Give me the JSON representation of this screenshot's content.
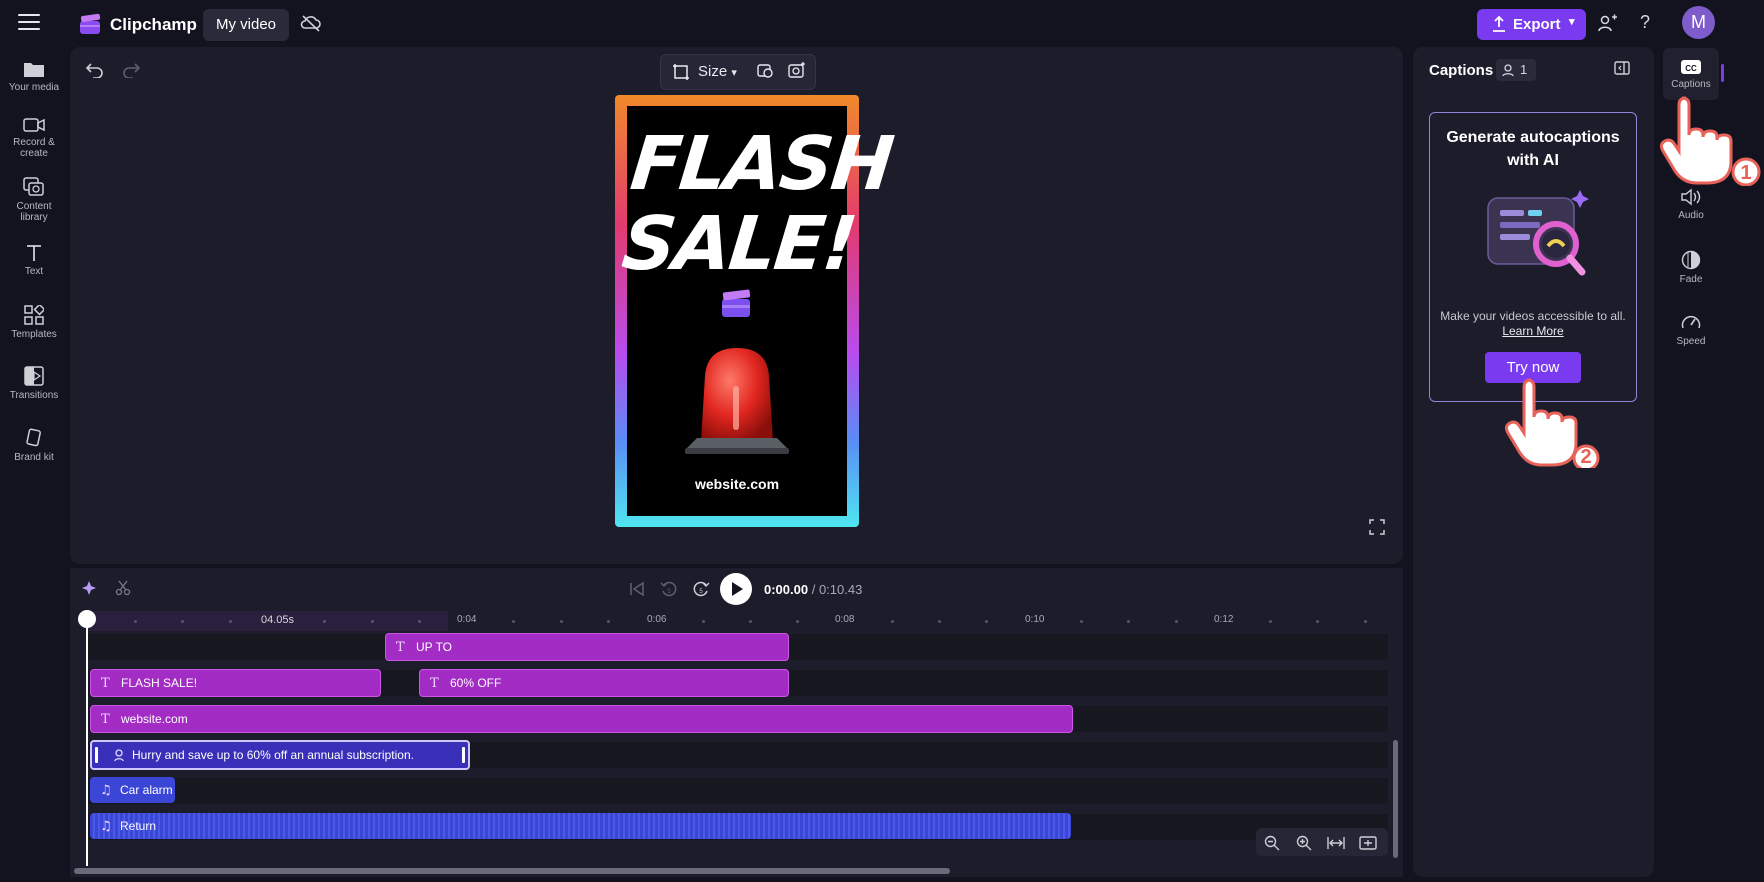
{
  "app": {
    "name": "Clipchamp",
    "project_name": "My video",
    "export_label": "Export",
    "avatar_initial": "M"
  },
  "sidebar": {
    "items": [
      {
        "label": "Your media",
        "icon": "folder-icon"
      },
      {
        "label": "Record & create",
        "icon": "camera-icon"
      },
      {
        "label": "Content library",
        "icon": "library-icon"
      },
      {
        "label": "Text",
        "icon": "text-icon"
      },
      {
        "label": "Templates",
        "icon": "templates-icon"
      },
      {
        "label": "Transitions",
        "icon": "transitions-icon"
      },
      {
        "label": "Brand kit",
        "icon": "brand-kit-icon"
      }
    ]
  },
  "preview": {
    "size_label": "Size",
    "video_title": "FLASH SALE!",
    "video_website": "website.com"
  },
  "captions_panel": {
    "title": "Captions",
    "badge_count": "1",
    "card_title": "Generate autocaptions with AI",
    "card_text": "Make your videos accessible to all.",
    "learn_more": "Learn More",
    "try_now": "Try now"
  },
  "right_rail": {
    "items": [
      {
        "label": "Captions",
        "icon": "cc-icon",
        "active": true
      },
      {
        "label": "Audio",
        "icon": "speaker-icon"
      },
      {
        "label": "Fade",
        "icon": "fade-icon"
      },
      {
        "label": "Speed",
        "icon": "speed-icon"
      }
    ]
  },
  "timeline": {
    "current_time": "0:00.00",
    "total_time": "/ 0:10.43",
    "playhead_label": "04.05s",
    "ruler_labels": [
      "0:04",
      "0:06",
      "0:08",
      "0:10",
      "0:12"
    ],
    "clips": {
      "up_to": "UP TO",
      "flash_sale": "FLASH SALE!",
      "sixty_off": "60% OFF",
      "website": "website.com",
      "caption": "Hurry and save up to 60% off an annual subscription.",
      "car_alarm": "Car alarm",
      "return": "Return"
    }
  },
  "annotations": {
    "step1": "1",
    "step2": "2"
  },
  "colors": {
    "accent": "#7a3af0",
    "text_clip": "#a32cc4",
    "audio_clip": "#3b46d6",
    "caption_clip": "#3a2fb8",
    "background": "#131320",
    "panel": "#1c1c2a"
  }
}
